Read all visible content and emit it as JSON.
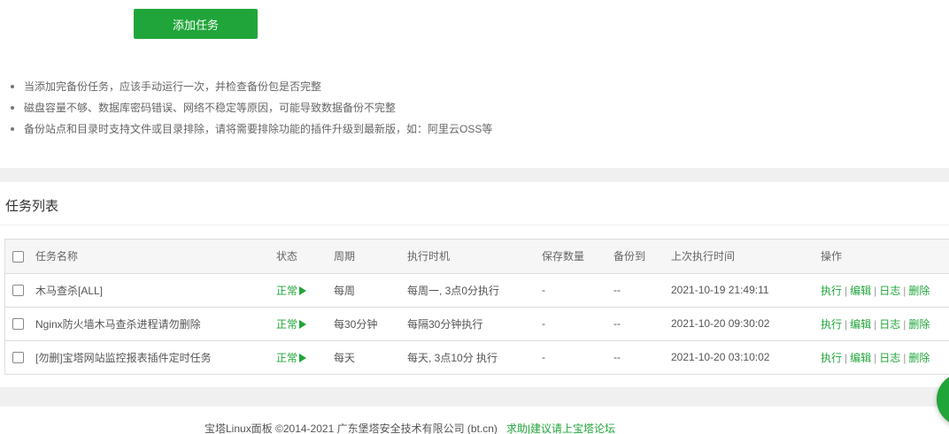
{
  "toolbar": {
    "add_task_label": "添加任务"
  },
  "tips": [
    "当添加完备份任务，应该手动运行一次，并检查备份包是否完整",
    "磁盘容量不够、数据库密码错误、网络不稳定等原因，可能导致数据备份不完整",
    "备份站点和目录时支持文件或目录排除，请将需要排除功能的插件升级到最新版，如：阿里云OSS等"
  ],
  "task_list": {
    "title": "任务列表",
    "columns": [
      "任务名称",
      "状态",
      "周期",
      "执行时机",
      "保存数量",
      "备份到",
      "上次执行时间",
      "操作"
    ],
    "rows": [
      {
        "name": "木马查杀[ALL]",
        "status": "正常",
        "cycle": "每周",
        "timing": "每周一, 3点0分执行",
        "keep": "-",
        "backup_to": "--",
        "last_run": "2021-10-19 21:49:11"
      },
      {
        "name": "Nginx防火墙木马查杀进程请勿删除",
        "status": "正常",
        "cycle": "每30分钟",
        "timing": "每隔30分钟执行",
        "keep": "-",
        "backup_to": "--",
        "last_run": "2021-10-20 09:30:02"
      },
      {
        "name": "[勿删]宝塔网站监控报表插件定时任务",
        "status": "正常",
        "cycle": "每天",
        "timing": "每天, 3点10分 执行",
        "keep": "-",
        "backup_to": "--",
        "last_run": "2021-10-20 03:10:02"
      }
    ],
    "actions": {
      "run": "执行",
      "edit": "编辑",
      "log": "日志",
      "delete": "删除",
      "separator": "|"
    }
  },
  "footer": {
    "copyright": "宝塔Linux面板 ©2014-2021 广东堡塔安全技术有限公司 (bt.cn)",
    "help_link": "求助|建议请上宝塔论坛"
  },
  "colors": {
    "accent": "#20a53a",
    "text": "#555555",
    "border": "#dddddd",
    "background": "#f0f0f0"
  },
  "icons": {
    "status_play": "play-icon",
    "float_button": "chat-bubble-icon"
  }
}
